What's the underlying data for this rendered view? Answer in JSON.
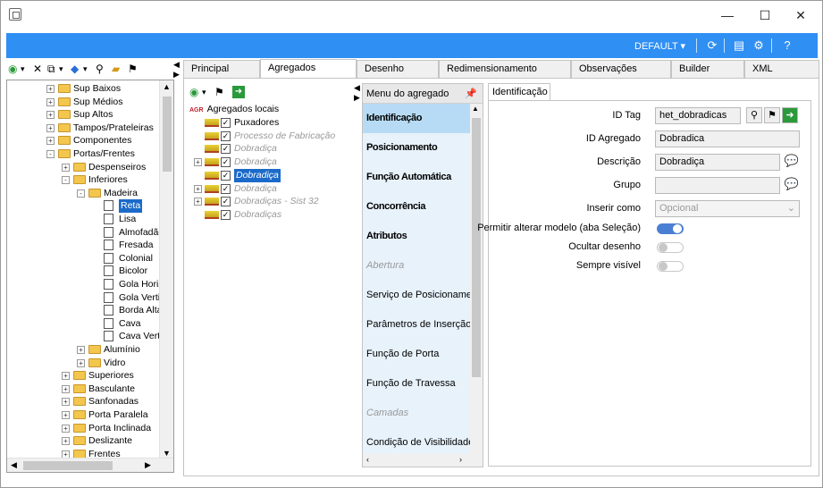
{
  "window": {
    "minimize": "—",
    "maximize": "☐",
    "close": "✕"
  },
  "topbar": {
    "profile": "DEFAULT"
  },
  "tree": {
    "items": [
      {
        "label": "Sup Baixos",
        "level": 0,
        "exp": "+",
        "type": "folder"
      },
      {
        "label": "Sup Médios",
        "level": 0,
        "exp": "+",
        "type": "folder"
      },
      {
        "label": "Sup Altos",
        "level": 0,
        "exp": "+",
        "type": "folder"
      },
      {
        "label": "Tampos/Prateleiras",
        "level": 0,
        "exp": "+",
        "type": "folder"
      },
      {
        "label": "Componentes",
        "level": 0,
        "exp": "+",
        "type": "folder"
      },
      {
        "label": "Portas/Frentes",
        "level": 0,
        "exp": "-",
        "type": "folder"
      },
      {
        "label": "Despenseiros",
        "level": 1,
        "exp": "+",
        "type": "folder"
      },
      {
        "label": "Inferiores",
        "level": 1,
        "exp": "-",
        "type": "folder"
      },
      {
        "label": "Madeira",
        "level": 2,
        "exp": "-",
        "type": "folder"
      },
      {
        "label": "Reta",
        "level": 3,
        "exp": "",
        "type": "doc",
        "selected": true
      },
      {
        "label": "Lisa",
        "level": 3,
        "exp": "",
        "type": "doc"
      },
      {
        "label": "Almofadão",
        "level": 3,
        "exp": "",
        "type": "doc"
      },
      {
        "label": "Fresada",
        "level": 3,
        "exp": "",
        "type": "doc"
      },
      {
        "label": "Colonial",
        "level": 3,
        "exp": "",
        "type": "doc"
      },
      {
        "label": "Bicolor",
        "level": 3,
        "exp": "",
        "type": "doc"
      },
      {
        "label": "Gola Horizontal",
        "level": 3,
        "exp": "",
        "type": "doc"
      },
      {
        "label": "Gola Vertical",
        "level": 3,
        "exp": "",
        "type": "doc"
      },
      {
        "label": "Borda Alta",
        "level": 3,
        "exp": "",
        "type": "doc"
      },
      {
        "label": "Cava",
        "level": 3,
        "exp": "",
        "type": "doc"
      },
      {
        "label": "Cava Vertical",
        "level": 3,
        "exp": "",
        "type": "doc"
      },
      {
        "label": "Alumínio",
        "level": 2,
        "exp": "+",
        "type": "folder"
      },
      {
        "label": "Vidro",
        "level": 2,
        "exp": "+",
        "type": "folder"
      },
      {
        "label": "Superiores",
        "level": 1,
        "exp": "+",
        "type": "folder"
      },
      {
        "label": "Basculante",
        "level": 1,
        "exp": "+",
        "type": "folder"
      },
      {
        "label": "Sanfonadas",
        "level": 1,
        "exp": "+",
        "type": "folder"
      },
      {
        "label": "Porta Paralela",
        "level": 1,
        "exp": "+",
        "type": "folder"
      },
      {
        "label": "Porta Inclinada",
        "level": 1,
        "exp": "+",
        "type": "folder"
      },
      {
        "label": "Deslizante",
        "level": 1,
        "exp": "+",
        "type": "folder"
      },
      {
        "label": "Frentes",
        "level": 1,
        "exp": "+",
        "type": "folder"
      }
    ]
  },
  "tabs": [
    "Principal",
    "Agregados",
    "Desenho",
    "Redimensionamento",
    "Observações",
    "Builder",
    "XML"
  ],
  "agregados": {
    "root_badge": "AGR",
    "root_label": "Agregados locais",
    "items": [
      {
        "label": "Puxadores",
        "style": "normal"
      },
      {
        "label": "Processo de Fabricação",
        "style": "grey"
      },
      {
        "label": "Dobradiça",
        "style": "grey"
      },
      {
        "label": "Dobradiça",
        "style": "grey"
      },
      {
        "label": "Dobradiça",
        "style": "selected"
      },
      {
        "label": "Dobradiça",
        "style": "grey"
      },
      {
        "label": "Dobradiças - Sist 32",
        "style": "grey"
      },
      {
        "label": "Dobradiças",
        "style": "grey"
      }
    ]
  },
  "menu": {
    "title": "Menu do agregado",
    "items": [
      {
        "label": "Identificação",
        "style": "bold active"
      },
      {
        "label": "Posicionamento",
        "style": "bold"
      },
      {
        "label": "Função Automática",
        "style": "bold"
      },
      {
        "label": "Concorrência",
        "style": "bold"
      },
      {
        "label": "Atributos",
        "style": "bold"
      },
      {
        "label": "Abertura",
        "style": "dis"
      },
      {
        "label": "Serviço de Posicionamento",
        "style": ""
      },
      {
        "label": "Parâmetros de Inserção",
        "style": ""
      },
      {
        "label": "Função de Porta",
        "style": ""
      },
      {
        "label": "Função de Travessa",
        "style": ""
      },
      {
        "label": "Camadas",
        "style": "dis"
      },
      {
        "label": "Condição de Visibilidade",
        "style": ""
      }
    ]
  },
  "ident": {
    "tab": "Identificação",
    "id_tag_label": "ID Tag",
    "id_tag_value": "het_dobradicas",
    "id_agregado_label": "ID Agregado",
    "id_agregado_value": "Dobradica",
    "descricao_label": "Descrição",
    "descricao_value": "Dobradiça",
    "grupo_label": "Grupo",
    "grupo_value": "",
    "inserir_label": "Inserir como",
    "inserir_value": "Opcional",
    "permitir_label": "Permitir alterar modelo (aba Seleção)",
    "permitir_on": true,
    "ocultar_label": "Ocultar desenho",
    "ocultar_on": false,
    "visivel_label": "Sempre visível",
    "visivel_on": false,
    "toggle_on_color": "#4a7fd4",
    "toggle_off_color": "#c8c8c8"
  }
}
